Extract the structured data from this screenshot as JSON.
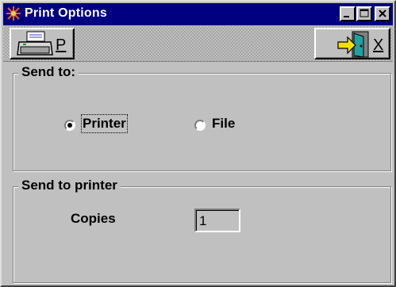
{
  "window": {
    "title": "Print Options",
    "colors": {
      "titlebar": "#000080",
      "face": "#c0c0c0"
    }
  },
  "toolbar": {
    "print_button": {
      "icon": "printer-icon",
      "label": "P"
    },
    "exit_button": {
      "icon": "exit-door-icon",
      "label": "X"
    }
  },
  "send_to": {
    "group_label": "Send to:",
    "options": [
      {
        "label": "Printer",
        "selected": true
      },
      {
        "label": "File",
        "selected": false
      }
    ]
  },
  "send_to_printer": {
    "group_label": "Send to printer",
    "copies_label": "Copies",
    "copies_value": "1"
  }
}
